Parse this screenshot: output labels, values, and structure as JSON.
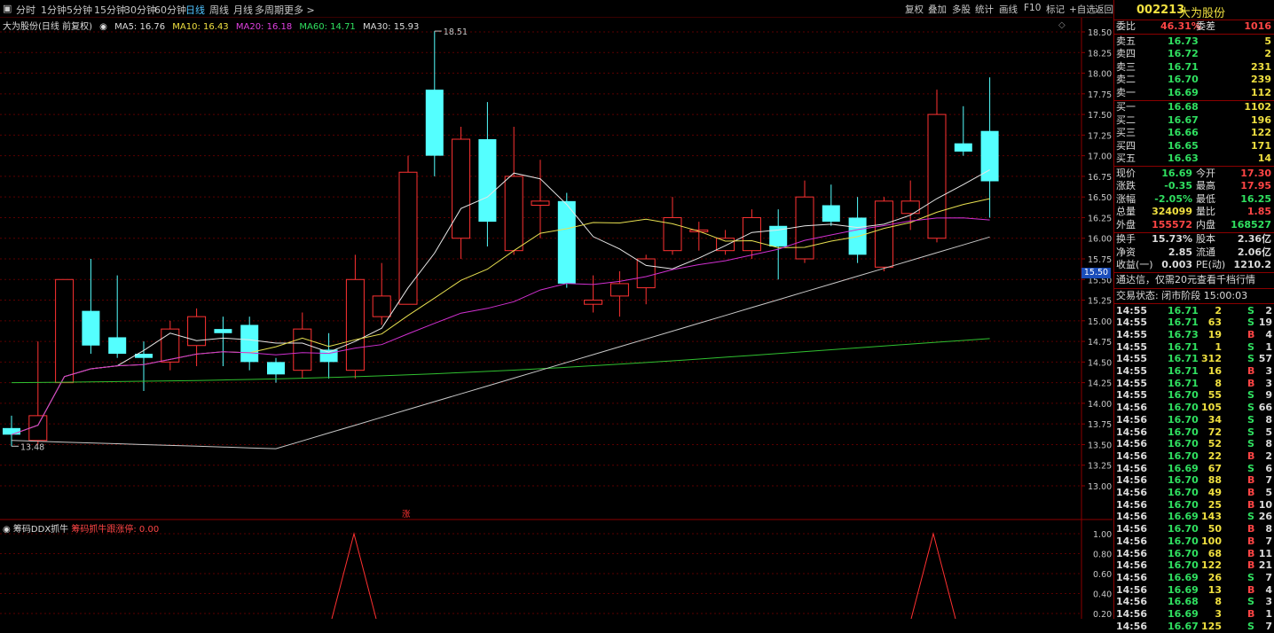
{
  "tabs": [
    "分时",
    "1分钟",
    "5分钟",
    "15分钟",
    "30分钟",
    "60分钟",
    "日线",
    "周线",
    "月线",
    "多周期",
    "更多 >"
  ],
  "active_tab": "日线",
  "toolbar": [
    "复权",
    "叠加",
    "多股",
    "统计",
    "画线",
    "F10",
    "标记",
    "+自选",
    "返回"
  ],
  "stock": {
    "code": "002213",
    "name": "大为股份"
  },
  "chart_info": {
    "name": "大为股份(日线 前复权)",
    "ma5": "MA5: 16.76",
    "ma10": "MA10: 16.43",
    "ma20": "MA20: 16.18",
    "ma60": "MA60: 14.71",
    "ma30": "MA30: 15.93"
  },
  "price_ticks": [
    "18.50",
    "18.25",
    "18.00",
    "17.75",
    "17.50",
    "17.25",
    "17.00",
    "16.75",
    "16.50",
    "16.25",
    "16.00",
    "15.75",
    "15.50",
    "15.25",
    "15.00",
    "14.75",
    "14.50",
    "14.25",
    "14.00",
    "13.75",
    "13.50",
    "13.25",
    "13.00"
  ],
  "current_tag": "15.50",
  "high_label": "18.51",
  "low_label": "13.48",
  "rise_marker": "涨",
  "indicator": {
    "name": "筹码DDX抓牛",
    "value_label": "筹码抓牛跟涨停: 0.00",
    "ticks": [
      "1.00",
      "0.80",
      "0.60",
      "0.40",
      "0.20"
    ]
  },
  "chart_data": {
    "type": "candlestick",
    "ylim": [
      12.75,
      18.75
    ],
    "candles": [
      [
        13.7,
        13.62,
        13.85,
        13.48
      ],
      [
        13.55,
        13.85,
        14.75,
        13.5
      ],
      [
        14.25,
        15.5,
        15.5,
        14.25
      ],
      [
        15.12,
        14.7,
        15.75,
        14.6
      ],
      [
        14.8,
        14.6,
        15.55,
        14.55
      ],
      [
        14.6,
        14.55,
        14.75,
        14.15
      ],
      [
        14.5,
        14.9,
        15.0,
        14.4
      ],
      [
        14.7,
        15.05,
        15.15,
        14.45
      ],
      [
        14.9,
        14.85,
        15.05,
        14.45
      ],
      [
        14.95,
        14.5,
        15.05,
        14.4
      ],
      [
        14.5,
        14.35,
        14.55,
        14.25
      ],
      [
        14.4,
        14.9,
        15.1,
        14.3
      ],
      [
        14.65,
        14.5,
        14.85,
        14.3
      ],
      [
        14.4,
        15.5,
        15.8,
        14.3
      ],
      [
        15.05,
        15.3,
        15.7,
        14.95
      ],
      [
        15.2,
        16.8,
        17.0,
        15.2
      ],
      [
        17.8,
        17.0,
        18.51,
        16.75
      ],
      [
        16.0,
        17.2,
        17.35,
        15.75
      ],
      [
        17.2,
        16.2,
        17.65,
        15.9
      ],
      [
        15.85,
        16.75,
        17.35,
        15.8
      ],
      [
        16.4,
        16.45,
        16.95,
        16.0
      ],
      [
        16.45,
        15.45,
        16.55,
        15.4
      ],
      [
        15.2,
        15.25,
        15.55,
        15.1
      ],
      [
        15.3,
        15.45,
        15.6,
        15.05
      ],
      [
        15.4,
        15.75,
        15.8,
        15.2
      ],
      [
        15.85,
        16.25,
        16.5,
        15.8
      ],
      [
        16.1,
        16.1,
        16.2,
        15.85
      ],
      [
        15.85,
        16.0,
        16.1,
        15.8
      ],
      [
        15.85,
        16.25,
        16.35,
        15.75
      ],
      [
        16.15,
        15.9,
        16.35,
        15.5
      ],
      [
        15.75,
        16.5,
        16.7,
        15.7
      ],
      [
        16.4,
        16.2,
        16.65,
        16.15
      ],
      [
        16.25,
        15.8,
        16.5,
        15.7
      ],
      [
        15.65,
        16.45,
        16.5,
        15.6
      ],
      [
        16.3,
        16.45,
        16.7,
        16.1
      ],
      [
        16.0,
        17.5,
        17.8,
        15.95
      ],
      [
        17.15,
        17.05,
        17.6,
        17.0
      ],
      [
        17.3,
        16.69,
        17.95,
        16.25
      ]
    ]
  },
  "quote": {
    "weibi": {
      "label": "委比",
      "value": "46.31%",
      "label2": "委差",
      "value2": "1016"
    },
    "asks": [
      [
        "卖五",
        "16.73",
        "5"
      ],
      [
        "卖四",
        "16.72",
        "2"
      ],
      [
        "卖三",
        "16.71",
        "231"
      ],
      [
        "卖二",
        "16.70",
        "239"
      ],
      [
        "卖一",
        "16.69",
        "112"
      ]
    ],
    "bids": [
      [
        "买一",
        "16.68",
        "1102"
      ],
      [
        "买二",
        "16.67",
        "196"
      ],
      [
        "买三",
        "16.66",
        "122"
      ],
      [
        "买四",
        "16.65",
        "171"
      ],
      [
        "买五",
        "16.63",
        "14"
      ]
    ],
    "stats": [
      [
        "现价",
        "16.69",
        "今开",
        "17.30"
      ],
      [
        "涨跌",
        "-0.35",
        "最高",
        "17.95"
      ],
      [
        "涨幅",
        "-2.05%",
        "最低",
        "16.25"
      ],
      [
        "总量",
        "324099",
        "量比",
        "1.85"
      ],
      [
        "外盘",
        "155572",
        "内盘",
        "168527"
      ],
      [
        "换手",
        "15.73%",
        "股本",
        "2.36亿"
      ],
      [
        "净资",
        "2.85",
        "流通",
        "2.06亿"
      ],
      [
        "收益(一)",
        "0.003",
        "PE(动)",
        "1210.2"
      ]
    ],
    "notice": "通达信，仅需20元查看千档行情",
    "status": "交易状态: 闭市阶段 15:00:03"
  },
  "trades": [
    [
      "14:55",
      "16.71",
      "2",
      "S",
      "2"
    ],
    [
      "14:55",
      "16.71",
      "63",
      "S",
      "19"
    ],
    [
      "14:55",
      "16.73",
      "19",
      "B",
      "4"
    ],
    [
      "14:55",
      "16.71",
      "1",
      "S",
      "1"
    ],
    [
      "14:55",
      "16.71",
      "312",
      "S",
      "57"
    ],
    [
      "14:55",
      "16.71",
      "16",
      "B",
      "3"
    ],
    [
      "14:55",
      "16.71",
      "8",
      "B",
      "3"
    ],
    [
      "14:55",
      "16.70",
      "55",
      "S",
      "9"
    ],
    [
      "14:56",
      "16.70",
      "105",
      "S",
      "66"
    ],
    [
      "14:56",
      "16.70",
      "34",
      "S",
      "8"
    ],
    [
      "14:56",
      "16.70",
      "72",
      "S",
      "5"
    ],
    [
      "14:56",
      "16.70",
      "52",
      "S",
      "8"
    ],
    [
      "14:56",
      "16.70",
      "22",
      "B",
      "2"
    ],
    [
      "14:56",
      "16.69",
      "67",
      "S",
      "6"
    ],
    [
      "14:56",
      "16.70",
      "88",
      "B",
      "7"
    ],
    [
      "14:56",
      "16.70",
      "49",
      "B",
      "5"
    ],
    [
      "14:56",
      "16.70",
      "25",
      "B",
      "10"
    ],
    [
      "14:56",
      "16.69",
      "143",
      "S",
      "26"
    ],
    [
      "14:56",
      "16.70",
      "50",
      "B",
      "8"
    ],
    [
      "14:56",
      "16.70",
      "100",
      "B",
      "7"
    ],
    [
      "14:56",
      "16.70",
      "68",
      "B",
      "11"
    ],
    [
      "14:56",
      "16.70",
      "122",
      "B",
      "21"
    ],
    [
      "14:56",
      "16.69",
      "26",
      "S",
      "7"
    ],
    [
      "14:56",
      "16.69",
      "13",
      "B",
      "4"
    ],
    [
      "14:56",
      "16.68",
      "8",
      "S",
      "3"
    ],
    [
      "14:56",
      "16.69",
      "3",
      "B",
      "1"
    ],
    [
      "14:56",
      "16.67",
      "125",
      "S",
      "7"
    ]
  ]
}
